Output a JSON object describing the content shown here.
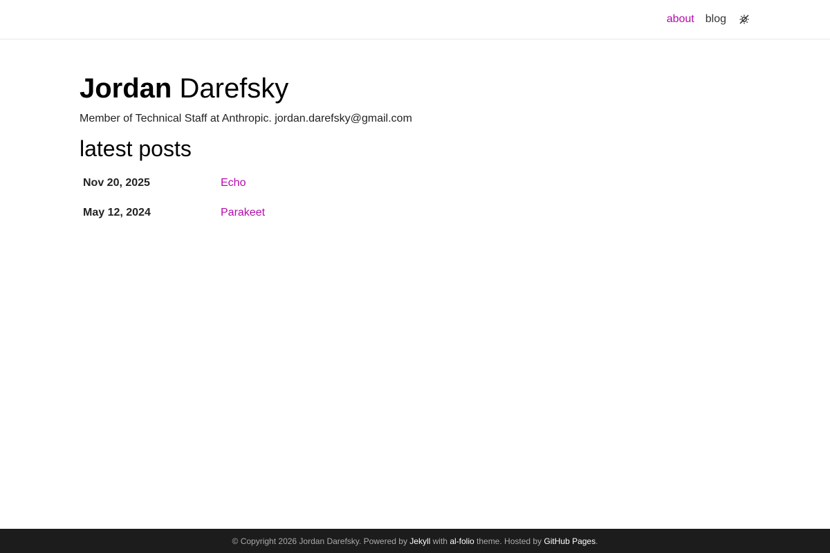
{
  "nav": {
    "about_label": "about",
    "blog_label": "blog",
    "theme_toggle_icon": "theme-toggle-icon",
    "accent_color": "#b509ac"
  },
  "header": {
    "first_name": "Jordan",
    "last_name": "Darefsky",
    "description": "Member of Technical Staff at Anthropic. jordan.darefsky@gmail.com"
  },
  "posts": {
    "title": "latest posts",
    "items": [
      {
        "date": "Nov 20, 2025",
        "title": "Echo"
      },
      {
        "date": "May 12, 2024",
        "title": "Parakeet"
      }
    ]
  },
  "footer": {
    "copyright": "© Copyright 2026 Jordan Darefsky. Powered by ",
    "jekyll": "Jekyll",
    "with": " with ",
    "alfolio": "al-folio",
    "theme_hosted": " theme. Hosted by ",
    "github_pages": "GitHub Pages",
    "end": ".",
    "background_color": "#1c1c1d"
  }
}
